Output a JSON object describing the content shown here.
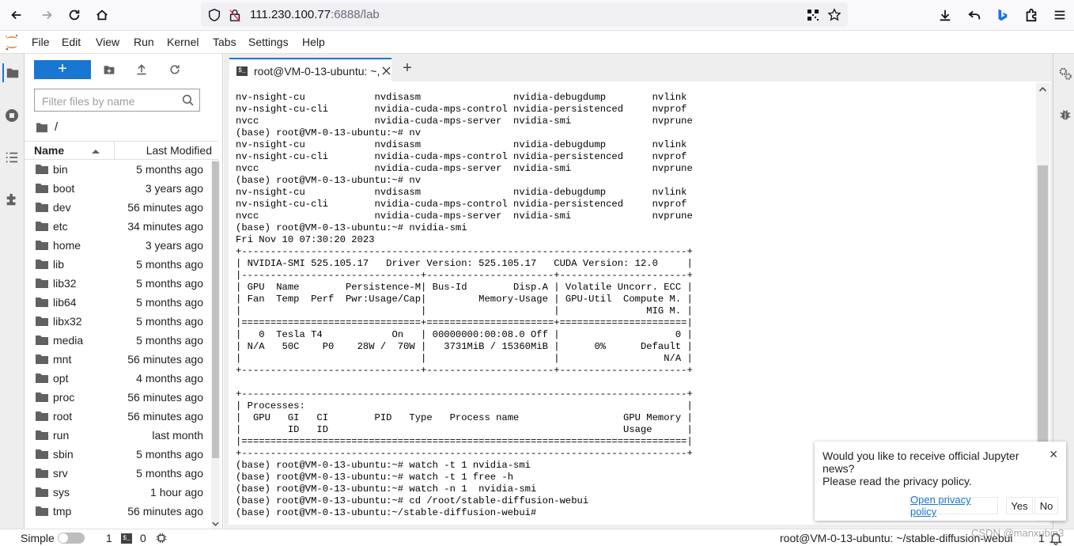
{
  "browser": {
    "url_host": "111.230.100.77",
    "url_rest": ":6888/lab"
  },
  "menu": [
    "File",
    "Edit",
    "View",
    "Run",
    "Kernel",
    "Tabs",
    "Settings",
    "Help"
  ],
  "filebrowser": {
    "new_label": "+",
    "filter_placeholder": "Filter files by name",
    "path": "/",
    "col_name": "Name",
    "col_modified": "Last Modified",
    "files": [
      {
        "name": "bin",
        "modified": "5 months ago"
      },
      {
        "name": "boot",
        "modified": "3 years ago"
      },
      {
        "name": "dev",
        "modified": "56 minutes ago"
      },
      {
        "name": "etc",
        "modified": "34 minutes ago"
      },
      {
        "name": "home",
        "modified": "3 years ago"
      },
      {
        "name": "lib",
        "modified": "5 months ago"
      },
      {
        "name": "lib32",
        "modified": "5 months ago"
      },
      {
        "name": "lib64",
        "modified": "5 months ago"
      },
      {
        "name": "libx32",
        "modified": "5 months ago"
      },
      {
        "name": "media",
        "modified": "5 months ago"
      },
      {
        "name": "mnt",
        "modified": "56 minutes ago"
      },
      {
        "name": "opt",
        "modified": "4 months ago"
      },
      {
        "name": "proc",
        "modified": "56 minutes ago"
      },
      {
        "name": "root",
        "modified": "56 minutes ago"
      },
      {
        "name": "run",
        "modified": "last month"
      },
      {
        "name": "sbin",
        "modified": "5 months ago"
      },
      {
        "name": "srv",
        "modified": "5 months ago"
      },
      {
        "name": "sys",
        "modified": "1 hour ago"
      },
      {
        "name": "tmp",
        "modified": "56 minutes ago"
      }
    ]
  },
  "tab": {
    "title": "root@VM-0-13-ubuntu: ~,",
    "add_label": "+"
  },
  "terminal": {
    "text": "nv-nsight-cu            nvdisasm                nvidia-debugdump        nvlink\nnv-nsight-cu-cli        nvidia-cuda-mps-control nvidia-persistenced     nvprof\nnvcc                    nvidia-cuda-mps-server  nvidia-smi              nvprune\n(base) root@VM-0-13-ubuntu:~# nv\nnv-nsight-cu            nvdisasm                nvidia-debugdump        nvlink\nnv-nsight-cu-cli        nvidia-cuda-mps-control nvidia-persistenced     nvprof\nnvcc                    nvidia-cuda-mps-server  nvidia-smi              nvprune\n(base) root@VM-0-13-ubuntu:~# nv\nnv-nsight-cu            nvdisasm                nvidia-debugdump        nvlink\nnv-nsight-cu-cli        nvidia-cuda-mps-control nvidia-persistenced     nvprof\nnvcc                    nvidia-cuda-mps-server  nvidia-smi              nvprune\n(base) root@VM-0-13-ubuntu:~# nvidia-smi\nFri Nov 10 07:30:20 2023\n+-----------------------------------------------------------------------------+\n| NVIDIA-SMI 525.105.17   Driver Version: 525.105.17   CUDA Version: 12.0     |\n|-------------------------------+----------------------+----------------------+\n| GPU  Name        Persistence-M| Bus-Id        Disp.A | Volatile Uncorr. ECC |\n| Fan  Temp  Perf  Pwr:Usage/Cap|         Memory-Usage | GPU-Util  Compute M. |\n|                               |                      |               MIG M. |\n|===============================+======================+======================|\n|   0  Tesla T4            On   | 00000000:00:08.0 Off |                    0 |\n| N/A   50C    P0    28W /  70W |   3731MiB / 15360MiB |      0%      Default |\n|                               |                      |                  N/A |\n+-------------------------------+----------------------+----------------------+\n\n+-----------------------------------------------------------------------------+\n| Processes:                                                                  |\n|  GPU   GI   CI        PID   Type   Process name                  GPU Memory |\n|        ID   ID                                                   Usage      |\n|=============================================================================|\n+-----------------------------------------------------------------------------+\n(base) root@VM-0-13-ubuntu:~# watch -t 1 nvidia-smi\n(base) root@VM-0-13-ubuntu:~# watch -t 1 free -h\n(base) root@VM-0-13-ubuntu:~# watch -n 1  nvidia-smi\n(base) root@VM-0-13-ubuntu:~# cd /root/stable-diffusion-webui\n(base) root@VM-0-13-ubuntu:~/stable-diffusion-webui#"
  },
  "notification": {
    "message_line1": "Would you like to receive official Jupyter news?",
    "message_line2": "Please read the privacy policy.",
    "link_label": "Open privacy policy",
    "yes_label": "Yes",
    "no_label": "No",
    "close_label": "✕"
  },
  "statusbar": {
    "mode_label": "Simple",
    "kernels_count": "1",
    "terminals_count": "0",
    "right_text": "root@VM-0-13-ubuntu: ~/stable-diffusion-webui",
    "page_num": "1",
    "watermark": "CSDN @manxubin3"
  },
  "colors": {
    "accent": "#1976d2",
    "jupyter_orange": "#f37726"
  }
}
